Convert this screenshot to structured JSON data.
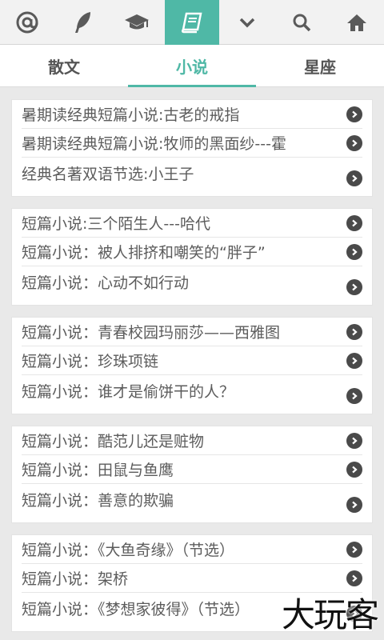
{
  "topbar": {
    "items": [
      {
        "icon": "at-icon"
      },
      {
        "icon": "feather-icon"
      },
      {
        "icon": "graduation-cap-icon"
      },
      {
        "icon": "book-icon",
        "active": true
      },
      {
        "icon": "chevron-down-icon"
      },
      {
        "icon": "search-icon"
      },
      {
        "icon": "home-icon"
      }
    ],
    "active_color": "#4fb8a6"
  },
  "tabs": [
    {
      "label": "散文"
    },
    {
      "label": "小说",
      "active": true
    },
    {
      "label": "星座"
    }
  ],
  "groups": [
    {
      "items": [
        "暑期读经典短篇小说:古老的戒指",
        "暑期读经典短篇小说:牧师的黑面纱---霍",
        "经典名著双语节选:小王子"
      ]
    },
    {
      "items": [
        "短篇小说:三个陌生人---哈代",
        "短篇小说：被人排挤和嘲笑的“胖子”",
        "短篇小说：心动不如行动"
      ]
    },
    {
      "items": [
        "短篇小说：青春校园玛丽莎——西雅图",
        "短篇小说：珍珠项链",
        "短篇小说：谁才是偷饼干的人？"
      ]
    },
    {
      "items": [
        "短篇小说：酷范儿还是赃物",
        "短篇小说：田鼠与鱼鹰",
        "短篇小说：善意的欺骗"
      ]
    },
    {
      "items": [
        "短篇小说：《大鱼奇缘》（节选）",
        "短篇小说：架桥",
        "短篇小说：《梦想家彼得》（节选）"
      ]
    }
  ],
  "watermark": "大玩客"
}
